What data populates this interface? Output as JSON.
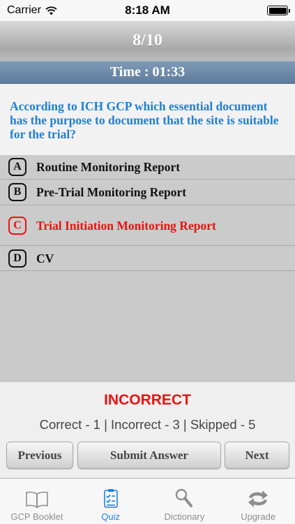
{
  "status_bar": {
    "carrier": "Carrier",
    "time": "8:18 AM"
  },
  "header": {
    "progress": "8/10"
  },
  "timer": {
    "text": "Time : 01:33"
  },
  "question": {
    "text": "According to ICH GCP which essential document has the purpose to document that the site is suitable for the trial?"
  },
  "options": [
    {
      "letter": "A",
      "text": "Routine Monitoring Report",
      "state": "normal"
    },
    {
      "letter": "B",
      "text": "Pre-Trial Monitoring Report",
      "state": "normal"
    },
    {
      "letter": "C",
      "text": "Trial Initiation Monitoring Report",
      "state": "incorrect"
    },
    {
      "letter": "D",
      "text": "CV",
      "state": "normal"
    }
  ],
  "feedback": {
    "result": "INCORRECT",
    "score": "Correct - 1 | Incorrect - 3 | Skipped - 5"
  },
  "buttons": {
    "previous": "Previous",
    "submit": "Submit Answer",
    "next": "Next"
  },
  "tabs": [
    {
      "label": "GCP Booklet",
      "icon": "book-icon",
      "active": false
    },
    {
      "label": "Quiz",
      "icon": "quiz-checklist-icon",
      "active": true
    },
    {
      "label": "Dictionary",
      "icon": "magnifier-icon",
      "active": false
    },
    {
      "label": "Upgrade",
      "icon": "sync-arrows-icon",
      "active": false
    }
  ],
  "colors": {
    "accent": "#1a82e8",
    "question_text": "#1e7fd9",
    "incorrect": "#e11111",
    "timer_bar": "#6d88a8"
  }
}
